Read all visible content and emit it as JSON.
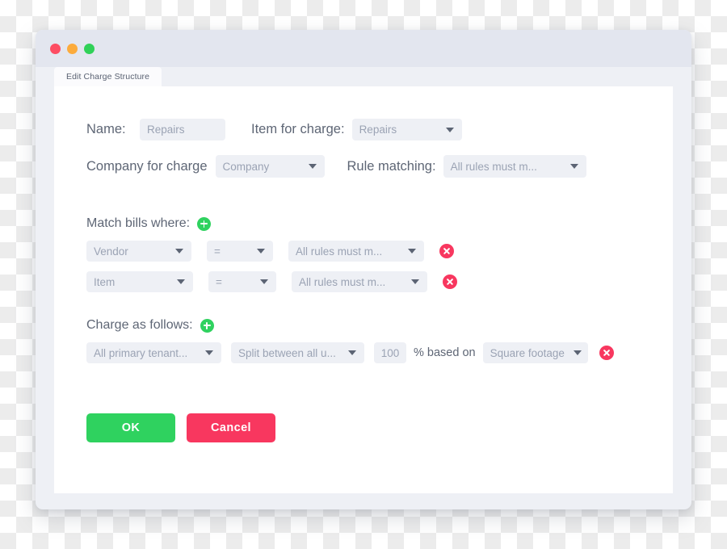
{
  "window": {
    "traffic_lights": [
      "close",
      "minimize",
      "maximize"
    ],
    "colors": {
      "close": "#fd4d63",
      "minimize": "#fcab3c",
      "maximize": "#30d158",
      "accent_green": "#2fd25f",
      "accent_red": "#f8375f",
      "field_bg": "#eef0f5",
      "chrome_bg": "#e3e6ef"
    }
  },
  "tab": {
    "label": "Edit Charge Structure"
  },
  "form": {
    "name": {
      "label": "Name:",
      "value": "Repairs",
      "placeholder": "Repairs"
    },
    "item_for_charge": {
      "label": "Item for charge:",
      "value": "Repairs"
    },
    "company_for_charge": {
      "label": "Company for charge",
      "value": "Company"
    },
    "rule_matching": {
      "label": "Rule matching:",
      "value": "All rules must m..."
    }
  },
  "match_bills": {
    "heading": "Match bills where:",
    "add_icon": "plus-circle-icon",
    "rows": [
      {
        "field": "Vendor",
        "operator": "=",
        "condition": "All rules must m...",
        "delete_icon": "close-circle-icon"
      },
      {
        "field": "Item",
        "operator": "=",
        "condition": "All rules must m...",
        "delete_icon": "close-circle-icon"
      }
    ]
  },
  "charge_as_follows": {
    "heading": "Charge as follows:",
    "add_icon": "plus-circle-icon",
    "rows": [
      {
        "target": "All primary tenant...",
        "method": "Split between all u...",
        "amount": "100",
        "unit_text": "% based on",
        "basis": "Square footage",
        "delete_icon": "close-circle-icon"
      }
    ]
  },
  "footer": {
    "ok_label": "OK",
    "cancel_label": "Cancel"
  }
}
